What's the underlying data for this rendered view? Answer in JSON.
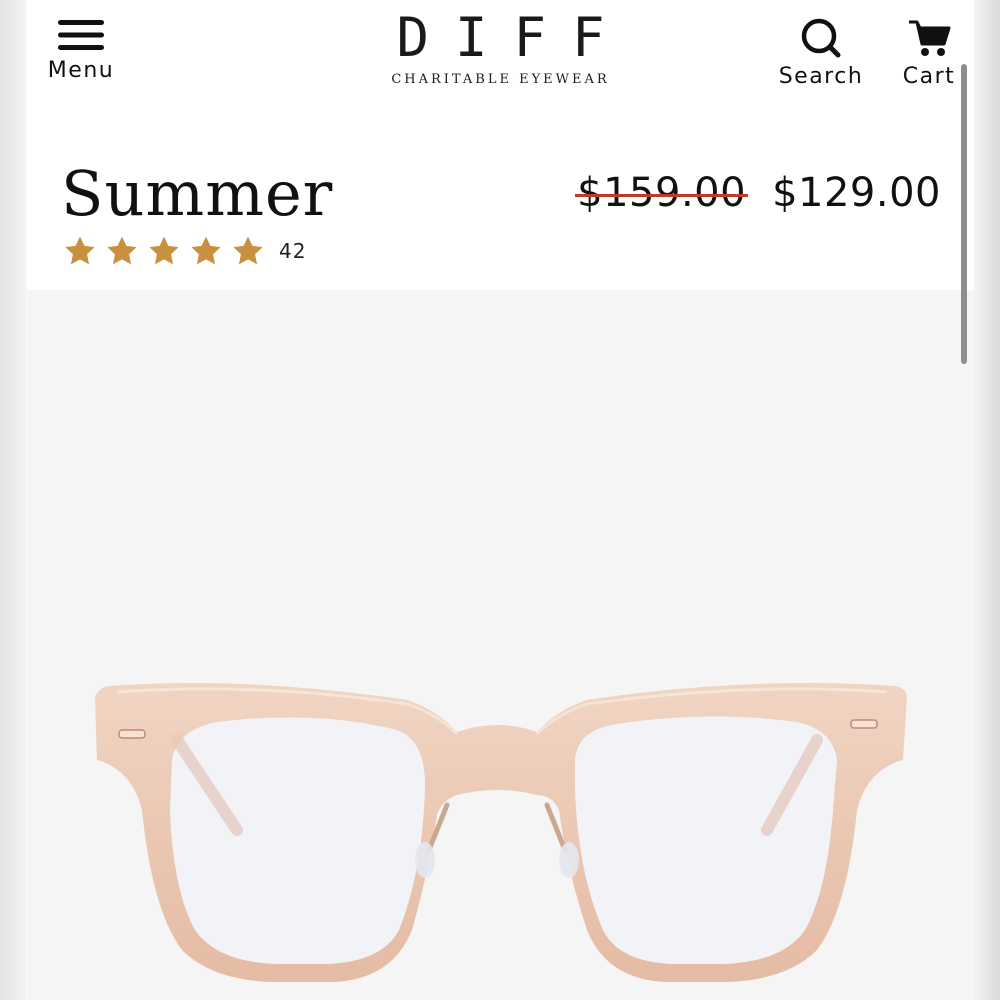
{
  "header": {
    "menu_label": "Menu",
    "search_label": "Search",
    "cart_label": "Cart",
    "logo_text": "DIFF",
    "logo_tagline": "CHARITABLE EYEWEAR"
  },
  "icons": {
    "menu": "hamburger-icon",
    "search": "search-icon",
    "cart": "cart-icon",
    "star": "star-icon"
  },
  "product": {
    "name": "Summer",
    "rating_stars": 5,
    "review_count": "42",
    "price_original": "$159.00",
    "price_sale": "$129.00"
  },
  "colors": {
    "star": "#C9913F",
    "strike": "#C0392B",
    "frame": "#E9C4AE",
    "gallery_bg": "#F5F5F5"
  }
}
